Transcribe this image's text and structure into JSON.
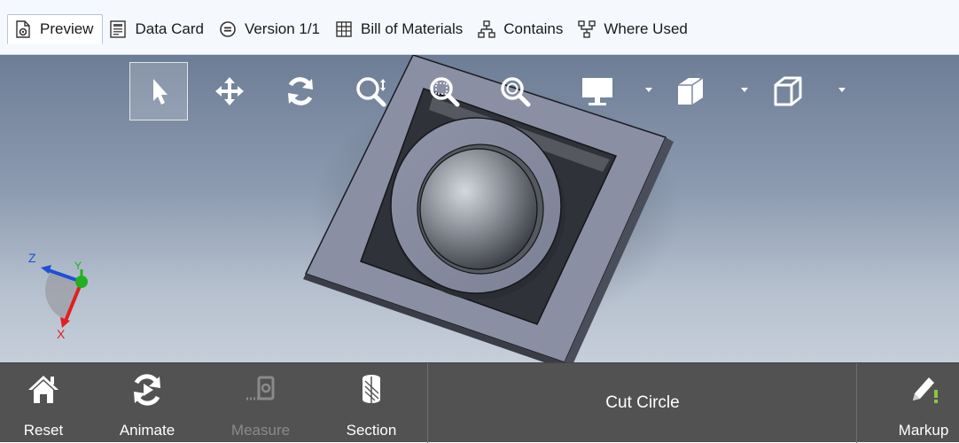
{
  "tabs": [
    {
      "label": "Preview",
      "icon": "preview-icon",
      "active": true
    },
    {
      "label": "Data Card",
      "icon": "data-card-icon",
      "active": false
    },
    {
      "label": "Version 1/1",
      "icon": "version-icon",
      "active": false
    },
    {
      "label": "Bill of Materials",
      "icon": "bill-of-materials-icon",
      "active": false
    },
    {
      "label": "Contains",
      "icon": "contains-icon",
      "active": false
    },
    {
      "label": "Where Used",
      "icon": "where-used-icon",
      "active": false
    }
  ],
  "viewer_toolbar": {
    "tools": [
      "select-icon",
      "pan-icon",
      "rotate-icon",
      "zoom-icon",
      "zoom-to-area-icon",
      "zoom-to-fit-icon",
      "display-icon",
      "view-orientation-icon",
      "standard-views-icon"
    ],
    "selected": "select-icon"
  },
  "triad": {
    "x": "X",
    "y": "Y",
    "z": "Z"
  },
  "bottom_bar": {
    "reset_label": "Reset",
    "animate_label": "Animate",
    "measure_label": "Measure",
    "section_label": "Section",
    "feature_name": "Cut Circle",
    "markup_label": "Markup"
  },
  "colors": {
    "tab_bar_bg": "#f5f8fc",
    "bottom_bar_bg": "#525252",
    "markup_accent": "#8cc63f",
    "axis_x": "#e02020",
    "axis_y": "#20b020",
    "axis_z": "#1f4fd8"
  }
}
